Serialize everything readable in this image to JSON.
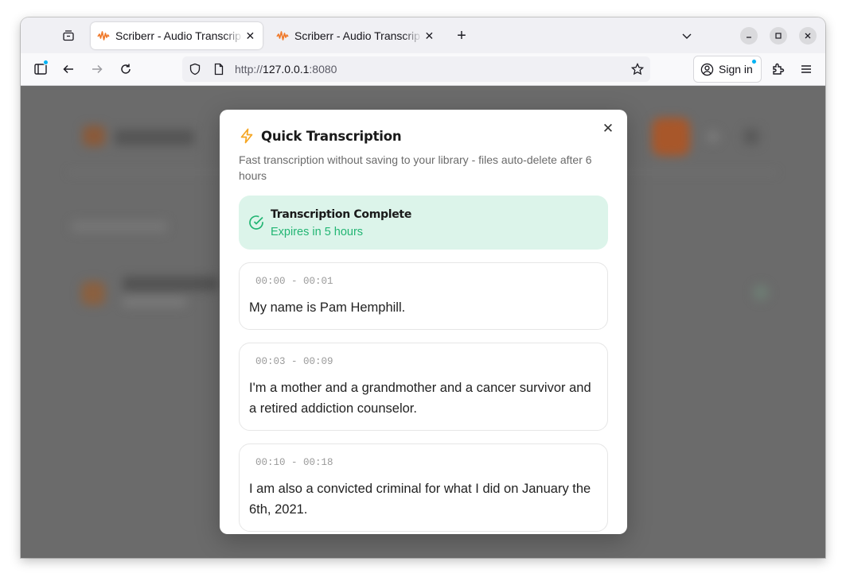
{
  "browser": {
    "tabs": [
      {
        "title": "Scriberr - Audio Transcrip",
        "active": true
      },
      {
        "title": "Scriberr - Audio Transcrip",
        "active": false
      }
    ],
    "new_tab_symbol": "+",
    "url_host": "http://",
    "url_main": "127.0.0.1",
    "url_port": ":8080",
    "signin_label": "Sign in",
    "icons": [
      "tab-overview-icon",
      "sidebar-icon",
      "back-icon",
      "forward-icon",
      "reload-icon",
      "shield-icon",
      "page-icon",
      "star-icon",
      "account-icon",
      "extensions-icon",
      "menu-icon",
      "minimize-icon",
      "maximize-icon",
      "close-icon",
      "tab-list-chevron-icon"
    ],
    "accent": "#00b3f4"
  },
  "modal": {
    "title": "Quick Transcription",
    "description": "Fast transcription without saving to your library - files auto-delete after 6 hours",
    "close_symbol": "✕",
    "status": {
      "title": "Transcription Complete",
      "subtitle": "Expires in 5 hours",
      "color": "#22b573",
      "background": "#dcf4ea"
    },
    "segments": [
      {
        "time": "00:00 - 00:01",
        "text": "My name is Pam Hemphill."
      },
      {
        "time": "00:03 - 00:09",
        "text": "I'm a mother and a grandmother and a cancer survivor and a retired addiction counselor."
      },
      {
        "time": "00:10 - 00:18",
        "text": "I am also a convicted criminal for what I did on January the 6th, 2021."
      }
    ],
    "accent": "#f5a623"
  }
}
